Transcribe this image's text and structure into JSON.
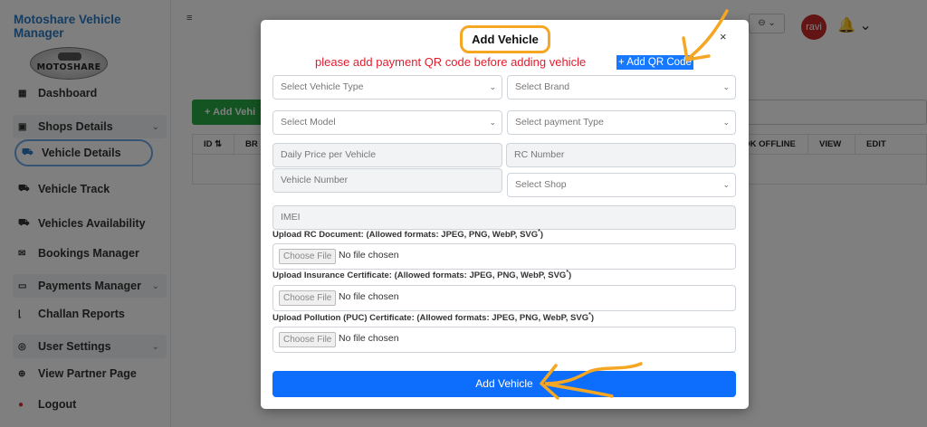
{
  "sidebar": {
    "brand": "Motoshare Vehicle Manager",
    "logo_text": "MOTOSHARE",
    "items": [
      {
        "label": "Dashboard",
        "icon": "grid-icon"
      },
      {
        "label": "Shops Details",
        "icon": "shop-icon",
        "chevron": "⌄"
      },
      {
        "label": "Vehicle Details",
        "icon": "car-icon",
        "active": true
      },
      {
        "label": "Vehicle Track",
        "icon": "car-icon"
      },
      {
        "label": "Vehicles Availability",
        "icon": "car-icon"
      },
      {
        "label": "Bookings Manager",
        "icon": "envelope-icon"
      },
      {
        "label": "Payments Manager",
        "icon": "card-icon",
        "chevron": "⌄"
      },
      {
        "label": "Challan Reports",
        "icon": "chart-icon"
      },
      {
        "label": "User Settings",
        "icon": "user-settings-icon",
        "chevron": "⌄"
      },
      {
        "label": "View Partner Page",
        "icon": "globe-icon"
      },
      {
        "label": "Logout",
        "icon": "logout-icon"
      }
    ]
  },
  "topbar": {
    "hamburger": "≡",
    "user_dropdown": "⊖ ⌄",
    "avatar": "ravi",
    "bell": "🔔 ⌄"
  },
  "background": {
    "add_button": "+ Add Vehi",
    "table_headers_left": [
      "ID ⇅",
      "BR"
    ],
    "table_headers_right": [
      "BOOK OFFLINE",
      "VIEW",
      "EDIT"
    ]
  },
  "modal": {
    "title": "Add Vehicle",
    "close": "×",
    "qr_note": "please add payment QR code before adding vehicle",
    "qr_button": "+ Add QR Code",
    "fields": {
      "vehicle_type": "Select Vehicle Type",
      "brand": "Select Brand",
      "model": "Select Model",
      "payment_type": "Select payment Type",
      "daily_price": "Daily Price per Vehicle",
      "rc_number": "RC Number",
      "vehicle_number": "Vehicle Number",
      "shop": "Select Shop",
      "imei": "IMEI"
    },
    "uploads": [
      {
        "label": "Upload RC Document: (Allowed formats: JPEG, PNG, WebP, SVG",
        "choose": "Choose File",
        "status": "No file chosen"
      },
      {
        "label": "Upload Insurance Certificate: (Allowed formats: JPEG, PNG, WebP, SVG",
        "choose": "Choose File",
        "status": "No file chosen"
      },
      {
        "label": "Upload Pollution (PUC) Certificate: (Allowed formats: JPEG, PNG, WebP, SVG",
        "choose": "Choose File",
        "status": "No file chosen"
      }
    ],
    "required_mark": "*",
    "required_suffix": ")",
    "submit": "Add Vehicle"
  },
  "colors": {
    "brand": "#2b79c2",
    "annotation_orange": "#f5a623",
    "primary_button": "#0d6efd",
    "qr_button": "#1677ff",
    "warning_text": "#e11d2d",
    "avatar": "#c62828",
    "add_button_bg": "#28a745"
  }
}
